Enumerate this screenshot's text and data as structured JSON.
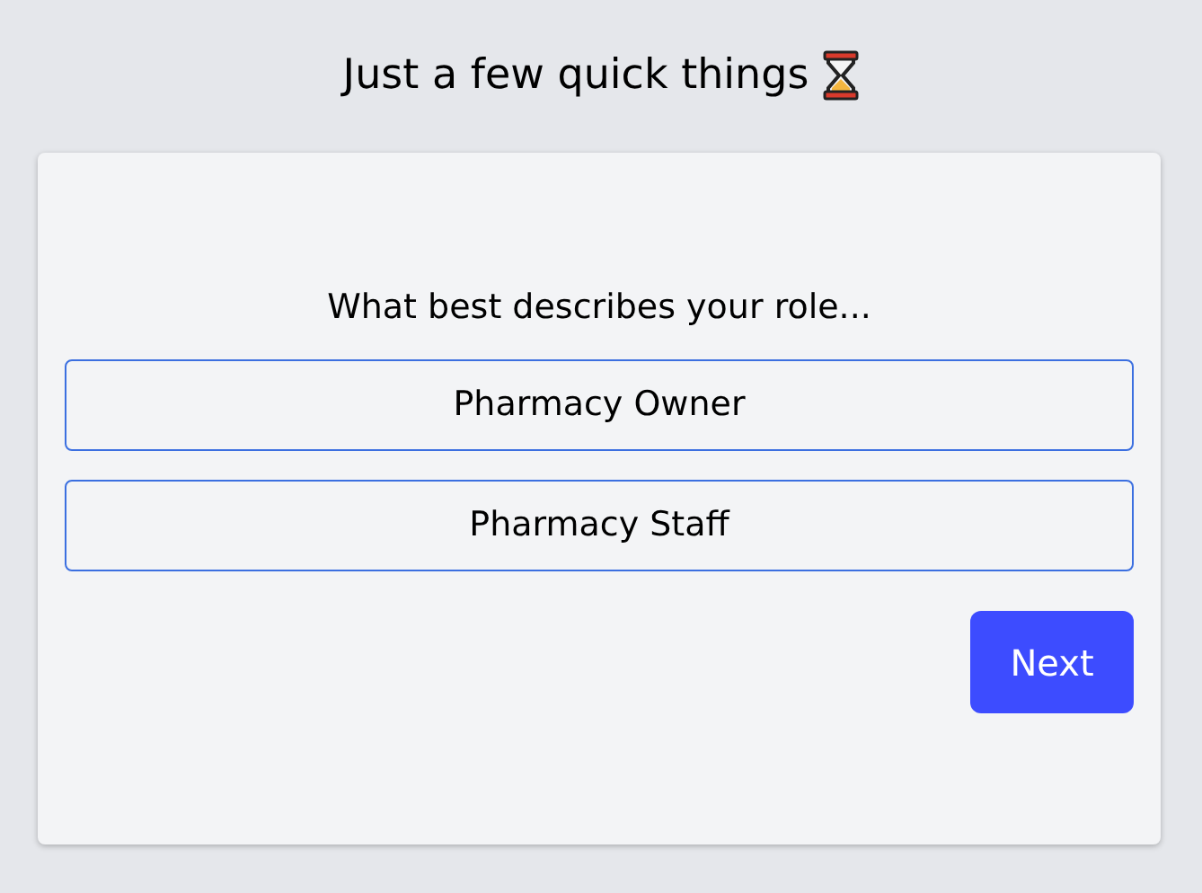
{
  "title": "Just a few quick things",
  "question": "What best describes your role...",
  "options": [
    {
      "label": "Pharmacy Owner"
    },
    {
      "label": "Pharmacy Staff"
    }
  ],
  "next_button": "Next"
}
